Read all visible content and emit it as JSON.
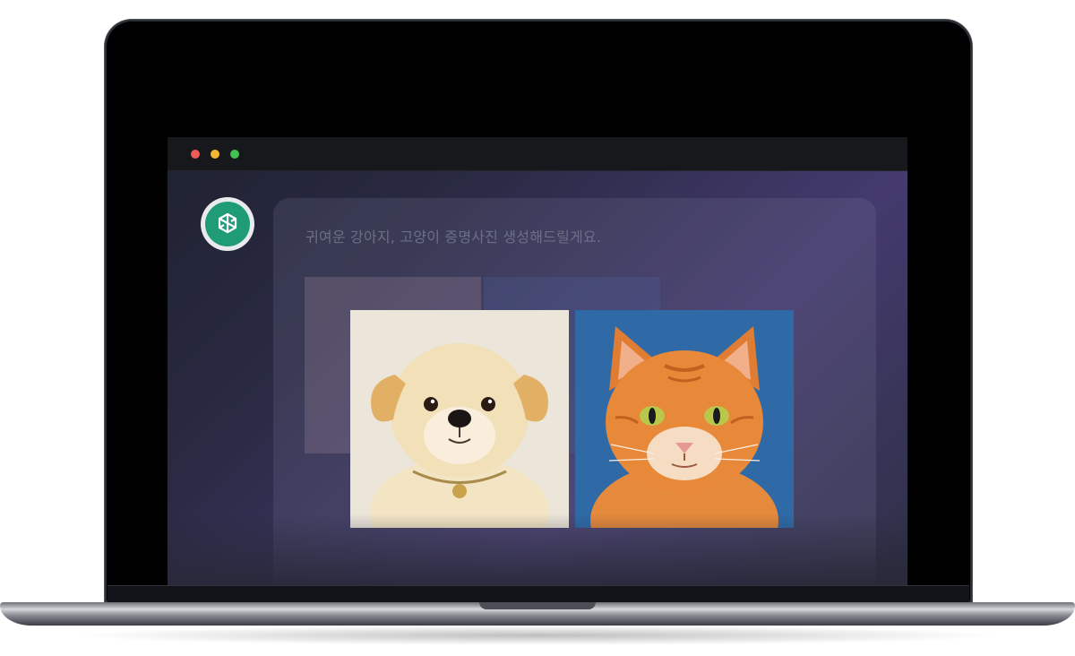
{
  "window": {
    "controls": [
      "close",
      "minimize",
      "maximize"
    ]
  },
  "assistant": {
    "icon": "openai-logo-icon"
  },
  "message": {
    "text": "귀여운 강아지, 고양이 증명사진 생성해드릴게요."
  },
  "images": [
    {
      "subject": "dog"
    },
    {
      "subject": "cat"
    }
  ],
  "colors": {
    "accent": "#1f9b76",
    "close": "#ef5b57",
    "minimize": "#f5b731",
    "maximize": "#3fc250",
    "cat_background": "#2f6aa7",
    "dog_background": "#e9e3d8"
  }
}
